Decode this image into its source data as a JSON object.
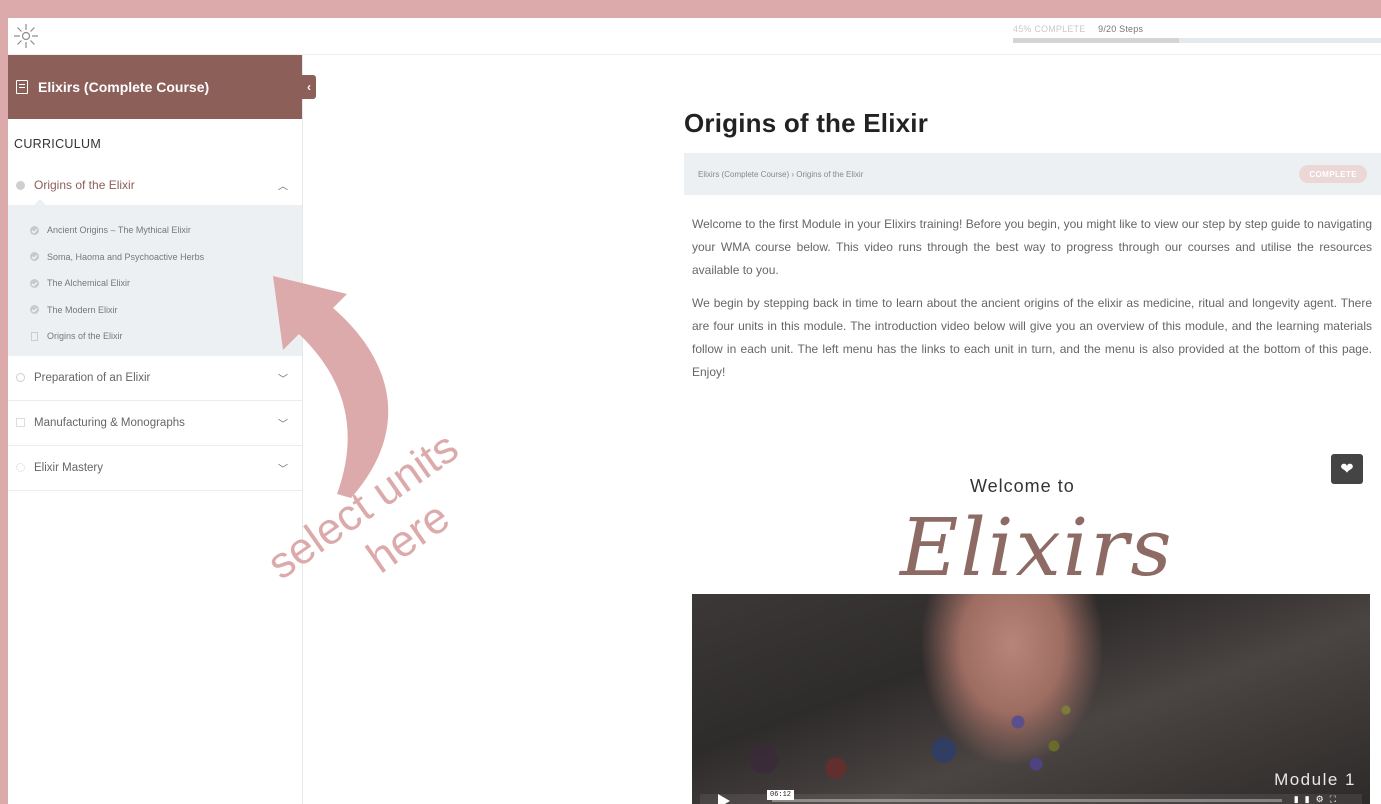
{
  "topbar": {
    "progress_label": "45% COMPLETE",
    "steps_label": "9/20 Steps",
    "progress_value": 0.45
  },
  "sidebar": {
    "course_title": "Elixirs (Complete Course)",
    "collapse_icon": "‹",
    "curriculum_label": "CURRICULUM",
    "lessons": [
      {
        "label": "Origins of the Elixir",
        "expanded": true
      },
      {
        "label": "Preparation of an Elixir"
      },
      {
        "label": "Manufacturing & Monographs"
      },
      {
        "label": "Elixir Mastery"
      }
    ],
    "units": [
      "Ancient Origins – The Mythical Elixir",
      "Soma, Haoma and Psychoactive Herbs",
      "The Alchemical Elixir",
      "The Modern Elixir",
      "Origins of the Elixir"
    ]
  },
  "annotation": {
    "line1": "select units",
    "line2": "here",
    "color": "#dcaaaa"
  },
  "main": {
    "title": "Origins of the Elixir",
    "breadcrumb": "Elixirs (Complete Course) › Origins of the Elixir",
    "status_badge": "COMPLETE",
    "paragraphs": [
      "Welcome to the first Module in your Elixirs training! Before you begin, you might like to view our step by step guide to navigating your WMA course below. This video runs through the best way to progress through our courses and utilise the resources available to you.",
      "We begin by stepping back in time to learn about the ancient origins of the elixir as medicine, ritual and longevity agent. There are four units in this module. The introduction video below will give you an overview of this module, and the learning materials follow in each unit. The left menu has the links to each unit in turn, and the menu is also provided at the bottom of this page. Enjoy!"
    ]
  },
  "video": {
    "welcome_text": "Welcome to",
    "brand_text": "Elixirs",
    "module_label": "Module 1",
    "time": "06:12"
  },
  "colors": {
    "brand": "#8c5f59",
    "background": "#dcaaaa"
  }
}
